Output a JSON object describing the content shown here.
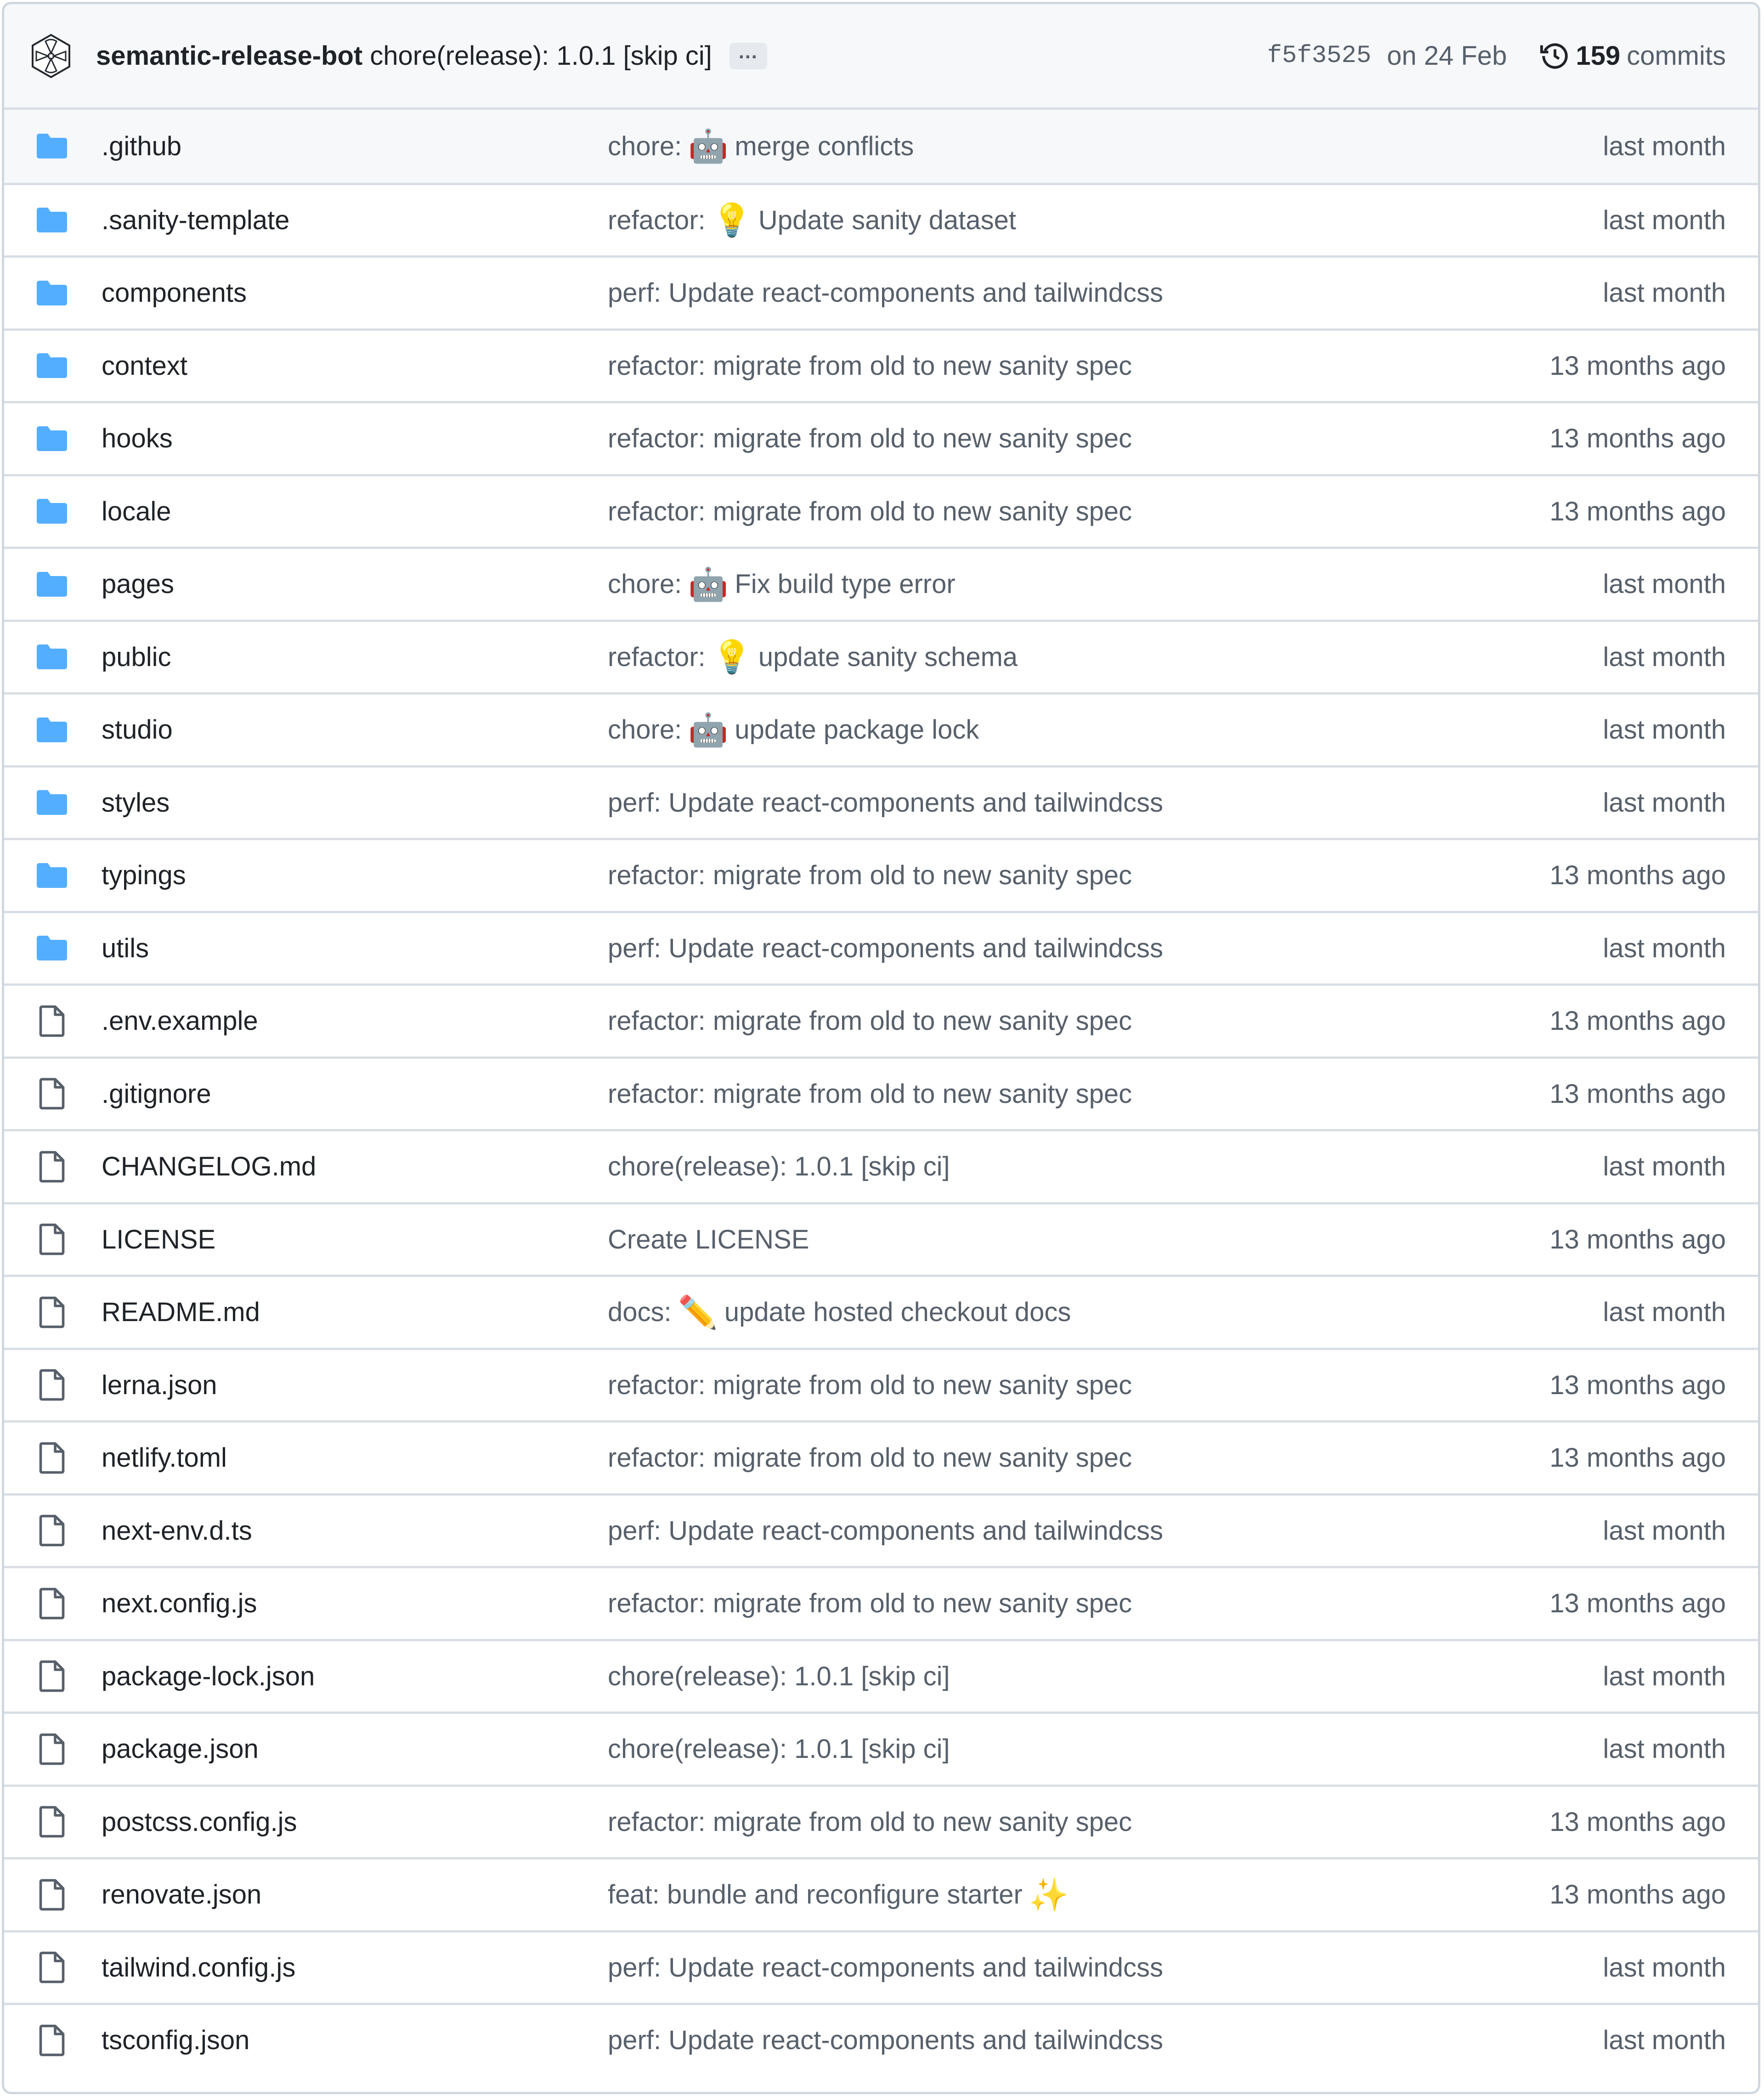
{
  "latest_commit": {
    "author": "semantic-release-bot",
    "message": "chore(release): 1.0.1 [skip ci]",
    "ellipsis": "…",
    "sha": "f5f3525",
    "date": "on 24 Feb",
    "commit_count": "159",
    "commits_label": "commits"
  },
  "colors": {
    "folder": "#54aeff",
    "file_icon": "#57606a",
    "header_bg": "#f6f8fa",
    "border": "#d0d7de"
  },
  "files": [
    {
      "type": "folder",
      "name": ".github",
      "prefix": "chore:",
      "emoji": "🤖",
      "message": "merge conflicts",
      "age": "last month"
    },
    {
      "type": "folder",
      "name": ".sanity-template",
      "prefix": "refactor:",
      "emoji": "💡",
      "message": "Update sanity dataset",
      "age": "last month"
    },
    {
      "type": "folder",
      "name": "components",
      "prefix": "",
      "emoji": "",
      "message": "perf: Update react-components and tailwindcss",
      "age": "last month"
    },
    {
      "type": "folder",
      "name": "context",
      "prefix": "",
      "emoji": "",
      "message": "refactor: migrate from old to new sanity spec",
      "age": "13 months ago"
    },
    {
      "type": "folder",
      "name": "hooks",
      "prefix": "",
      "emoji": "",
      "message": "refactor: migrate from old to new sanity spec",
      "age": "13 months ago"
    },
    {
      "type": "folder",
      "name": "locale",
      "prefix": "",
      "emoji": "",
      "message": "refactor: migrate from old to new sanity spec",
      "age": "13 months ago"
    },
    {
      "type": "folder",
      "name": "pages",
      "prefix": "chore:",
      "emoji": "🤖",
      "message": "Fix build type error",
      "age": "last month"
    },
    {
      "type": "folder",
      "name": "public",
      "prefix": "refactor:",
      "emoji": "💡",
      "message": "update sanity schema",
      "age": "last month"
    },
    {
      "type": "folder",
      "name": "studio",
      "prefix": "chore:",
      "emoji": "🤖",
      "message": "update package lock",
      "age": "last month"
    },
    {
      "type": "folder",
      "name": "styles",
      "prefix": "",
      "emoji": "",
      "message": "perf: Update react-components and tailwindcss",
      "age": "last month"
    },
    {
      "type": "folder",
      "name": "typings",
      "prefix": "",
      "emoji": "",
      "message": "refactor: migrate from old to new sanity spec",
      "age": "13 months ago"
    },
    {
      "type": "folder",
      "name": "utils",
      "prefix": "",
      "emoji": "",
      "message": "perf: Update react-components and tailwindcss",
      "age": "last month"
    },
    {
      "type": "file",
      "name": ".env.example",
      "prefix": "",
      "emoji": "",
      "message": "refactor: migrate from old to new sanity spec",
      "age": "13 months ago"
    },
    {
      "type": "file",
      "name": ".gitignore",
      "prefix": "",
      "emoji": "",
      "message": "refactor: migrate from old to new sanity spec",
      "age": "13 months ago"
    },
    {
      "type": "file",
      "name": "CHANGELOG.md",
      "prefix": "",
      "emoji": "",
      "message": "chore(release): 1.0.1 [skip ci]",
      "age": "last month"
    },
    {
      "type": "file",
      "name": "LICENSE",
      "prefix": "",
      "emoji": "",
      "message": "Create LICENSE",
      "age": "13 months ago"
    },
    {
      "type": "file",
      "name": "README.md",
      "prefix": "docs:",
      "emoji": "✏️",
      "message": "update hosted checkout docs",
      "age": "last month"
    },
    {
      "type": "file",
      "name": "lerna.json",
      "prefix": "",
      "emoji": "",
      "message": "refactor: migrate from old to new sanity spec",
      "age": "13 months ago"
    },
    {
      "type": "file",
      "name": "netlify.toml",
      "prefix": "",
      "emoji": "",
      "message": "refactor: migrate from old to new sanity spec",
      "age": "13 months ago"
    },
    {
      "type": "file",
      "name": "next-env.d.ts",
      "prefix": "",
      "emoji": "",
      "message": "perf: Update react-components and tailwindcss",
      "age": "last month"
    },
    {
      "type": "file",
      "name": "next.config.js",
      "prefix": "",
      "emoji": "",
      "message": "refactor: migrate from old to new sanity spec",
      "age": "13 months ago"
    },
    {
      "type": "file",
      "name": "package-lock.json",
      "prefix": "",
      "emoji": "",
      "message": "chore(release): 1.0.1 [skip ci]",
      "age": "last month"
    },
    {
      "type": "file",
      "name": "package.json",
      "prefix": "",
      "emoji": "",
      "message": "chore(release): 1.0.1 [skip ci]",
      "age": "last month"
    },
    {
      "type": "file",
      "name": "postcss.config.js",
      "prefix": "",
      "emoji": "",
      "message": "refactor: migrate from old to new sanity spec",
      "age": "13 months ago"
    },
    {
      "type": "file",
      "name": "renovate.json",
      "prefix": "",
      "emoji": "",
      "message": "feat: bundle and reconfigure starter",
      "suffix_emoji": "✨",
      "age": "13 months ago"
    },
    {
      "type": "file",
      "name": "tailwind.config.js",
      "prefix": "",
      "emoji": "",
      "message": "perf: Update react-components and tailwindcss",
      "age": "last month"
    },
    {
      "type": "file",
      "name": "tsconfig.json",
      "prefix": "",
      "emoji": "",
      "message": "perf: Update react-components and tailwindcss",
      "age": "last month"
    }
  ]
}
